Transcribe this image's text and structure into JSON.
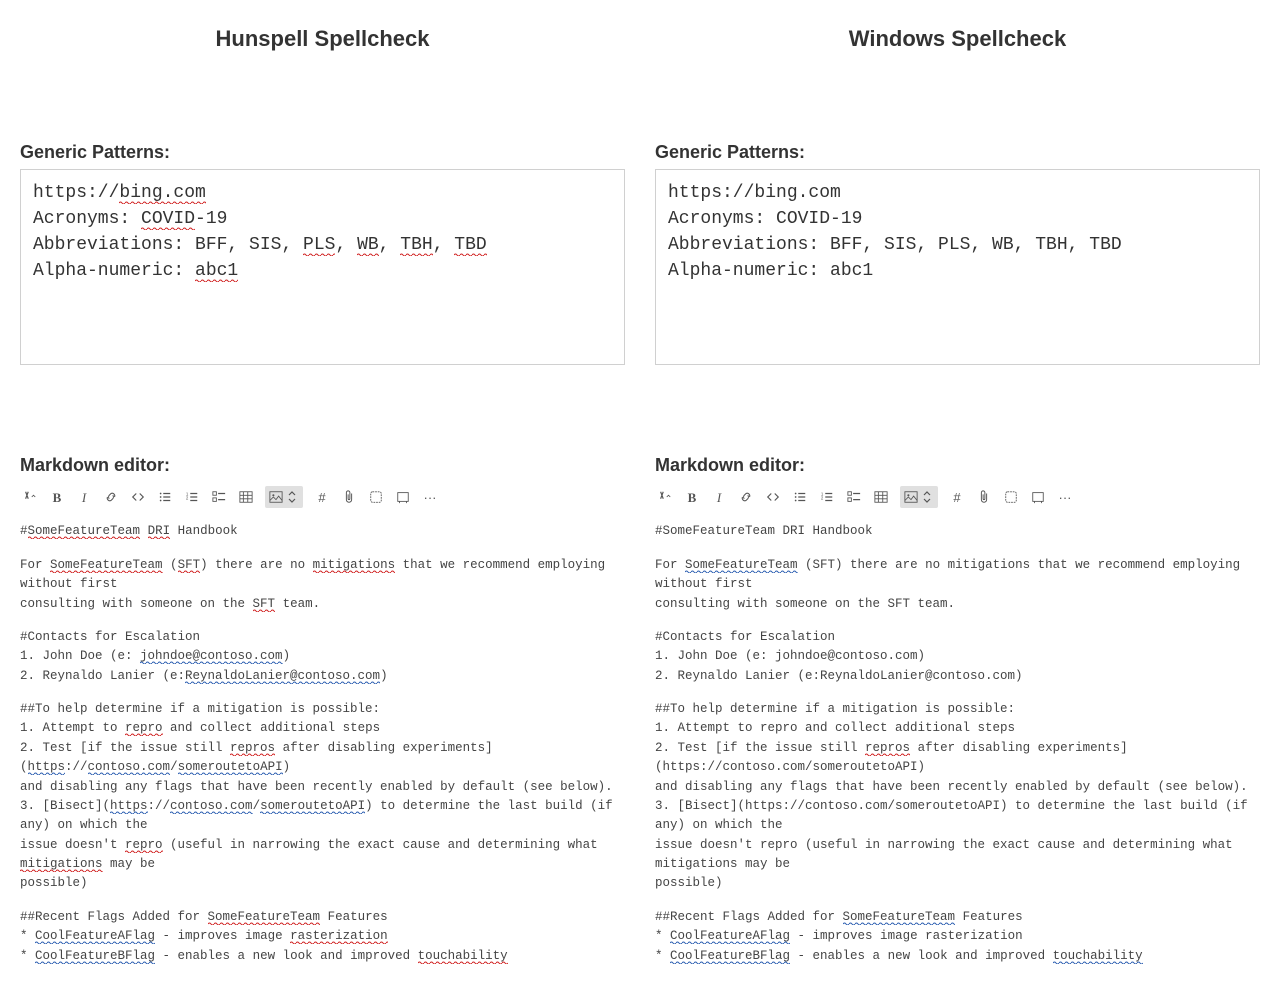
{
  "left": {
    "title": "Hunspell Spellcheck",
    "generic_label": "Generic Patterns:",
    "code": {
      "segments": [
        [
          {
            "t": "https://"
          },
          {
            "t": "bing.com",
            "u": "red"
          }
        ],
        [
          {
            "t": "Acronyms: "
          },
          {
            "t": "COVID",
            "u": "red"
          },
          {
            "t": "-19"
          }
        ],
        [
          {
            "t": "Abbreviations: BFF, SIS, "
          },
          {
            "t": "PLS",
            "u": "red"
          },
          {
            "t": ", "
          },
          {
            "t": "WB",
            "u": "red"
          },
          {
            "t": ", "
          },
          {
            "t": "TBH",
            "u": "red"
          },
          {
            "t": ", "
          },
          {
            "t": "TBD",
            "u": "red"
          }
        ],
        [
          {
            "t": "Alpha-numeric: "
          },
          {
            "t": "abc1",
            "u": "red"
          }
        ]
      ]
    },
    "md_label": "Markdown editor:",
    "md": {
      "paras": [
        [
          [
            {
              "t": "#"
            },
            {
              "t": "SomeFeatureTeam",
              "u": "red"
            },
            {
              "t": " "
            },
            {
              "t": "DRI",
              "u": "red"
            },
            {
              "t": " Handbook"
            }
          ]
        ],
        [
          [
            {
              "t": "For "
            },
            {
              "t": "SomeFeatureTeam",
              "u": "red"
            },
            {
              "t": " ("
            },
            {
              "t": "SFT",
              "u": "red"
            },
            {
              "t": ") there are no "
            },
            {
              "t": "mitigations",
              "u": "red"
            },
            {
              "t": " that we recommend employing without first"
            }
          ],
          [
            {
              "t": "consulting with someone on the "
            },
            {
              "t": "SFT",
              "u": "red"
            },
            {
              "t": " team."
            }
          ]
        ],
        [
          [
            {
              "t": "#Contacts for Escalation"
            }
          ],
          [
            {
              "t": "1. John Doe (e: "
            },
            {
              "t": "johndoe@contoso.com",
              "u": "blue"
            },
            {
              "t": ")"
            }
          ],
          [
            {
              "t": "2. Reynaldo Lanier (e:"
            },
            {
              "t": "ReynaldoLanier@contoso.com",
              "u": "blue"
            },
            {
              "t": ")"
            }
          ]
        ],
        [
          [
            {
              "t": "##To help determine if a mitigation is possible:"
            }
          ],
          [
            {
              "t": "1. Attempt to "
            },
            {
              "t": "repro",
              "u": "red"
            },
            {
              "t": " and collect additional steps"
            }
          ],
          [
            {
              "t": "2. Test [if the issue still "
            },
            {
              "t": "repros",
              "u": "red"
            },
            {
              "t": " after disabling experiments]("
            },
            {
              "t": "https",
              "u": "blue"
            },
            {
              "t": "://"
            },
            {
              "t": "contoso.com",
              "u": "blue"
            },
            {
              "t": "/"
            },
            {
              "t": "someroutetoAPI",
              "u": "blue"
            },
            {
              "t": ")"
            }
          ],
          [
            {
              "t": "and disabling any flags that have been recently enabled by default (see below)."
            }
          ],
          [
            {
              "t": "3. [Bisect]("
            },
            {
              "t": "https",
              "u": "blue"
            },
            {
              "t": "://"
            },
            {
              "t": "contoso.com",
              "u": "blue"
            },
            {
              "t": "/"
            },
            {
              "t": "someroutetoAPI",
              "u": "blue"
            },
            {
              "t": ") to determine the last build (if any) on which the"
            }
          ],
          [
            {
              "t": "issue doesn't "
            },
            {
              "t": "repro",
              "u": "red"
            },
            {
              "t": " (useful in narrowing the exact cause and determining what "
            },
            {
              "t": "mitigations",
              "u": "red"
            },
            {
              "t": " may be"
            }
          ],
          [
            {
              "t": "possible)"
            }
          ]
        ],
        [
          [
            {
              "t": "##Recent Flags Added for "
            },
            {
              "t": "SomeFeatureTeam",
              "u": "red"
            },
            {
              "t": " Features"
            }
          ],
          [
            {
              "t": "* "
            },
            {
              "t": "CoolFeatureAFlag",
              "u": "blue"
            },
            {
              "t": " - improves image "
            },
            {
              "t": "rasterization",
              "u": "red"
            }
          ],
          [
            {
              "t": "* "
            },
            {
              "t": "CoolFeatureBFlag",
              "u": "blue"
            },
            {
              "t": " - enables a new look and improved "
            },
            {
              "t": "touchability",
              "u": "red"
            }
          ]
        ]
      ]
    }
  },
  "right": {
    "title": "Windows Spellcheck",
    "generic_label": "Generic Patterns:",
    "code": {
      "segments": [
        [
          {
            "t": "https://bing.com"
          }
        ],
        [
          {
            "t": "Acronyms: COVID-19"
          }
        ],
        [
          {
            "t": "Abbreviations: BFF, SIS, PLS, WB, TBH, TBD"
          }
        ],
        [
          {
            "t": "Alpha-numeric: abc1"
          }
        ]
      ]
    },
    "md_label": "Markdown editor:",
    "md": {
      "paras": [
        [
          [
            {
              "t": "#SomeFeatureTeam DRI Handbook"
            }
          ]
        ],
        [
          [
            {
              "t": "For "
            },
            {
              "t": "SomeFeatureTeam",
              "u": "blue"
            },
            {
              "t": " (SFT) there are no mitigations that we recommend employing without first"
            }
          ],
          [
            {
              "t": "consulting with someone on the SFT team."
            }
          ]
        ],
        [
          [
            {
              "t": "#Contacts for Escalation"
            }
          ],
          [
            {
              "t": "1. John Doe (e: johndoe@contoso.com)"
            }
          ],
          [
            {
              "t": "2. Reynaldo Lanier (e:ReynaldoLanier@contoso.com)"
            }
          ]
        ],
        [
          [
            {
              "t": "##To help determine if a mitigation is possible:"
            }
          ],
          [
            {
              "t": "1. Attempt to repro and collect additional steps"
            }
          ],
          [
            {
              "t": "2. Test [if the issue still "
            },
            {
              "t": "repros",
              "u": "red"
            },
            {
              "t": " after disabling experiments](https://contoso.com/someroutetoAPI)"
            }
          ],
          [
            {
              "t": "and disabling any flags that have been recently enabled by default (see below)."
            }
          ],
          [
            {
              "t": "3. [Bisect](https://contoso.com/someroutetoAPI) to determine the last build (if any) on which the"
            }
          ],
          [
            {
              "t": "issue doesn't repro (useful in narrowing the exact cause and determining what mitigations may be"
            }
          ],
          [
            {
              "t": "possible)"
            }
          ]
        ],
        [
          [
            {
              "t": "##Recent Flags Added for "
            },
            {
              "t": "SomeFeatureTeam",
              "u": "blue"
            },
            {
              "t": " Features"
            }
          ],
          [
            {
              "t": "* "
            },
            {
              "t": "CoolFeatureAFlag",
              "u": "blue"
            },
            {
              "t": " - improves image rasterization"
            }
          ],
          [
            {
              "t": "* "
            },
            {
              "t": "CoolFeatureBFlag",
              "u": "blue"
            },
            {
              "t": " - enables a new look and improved "
            },
            {
              "t": "touchability",
              "u": "blue"
            }
          ]
        ]
      ]
    }
  },
  "toolbar_icons": [
    "heading",
    "bold",
    "italic",
    "link",
    "code",
    "ul",
    "ol",
    "checklist",
    "table",
    "image",
    "updown",
    "hash",
    "attach",
    "mention",
    "fullscreen",
    "more"
  ]
}
